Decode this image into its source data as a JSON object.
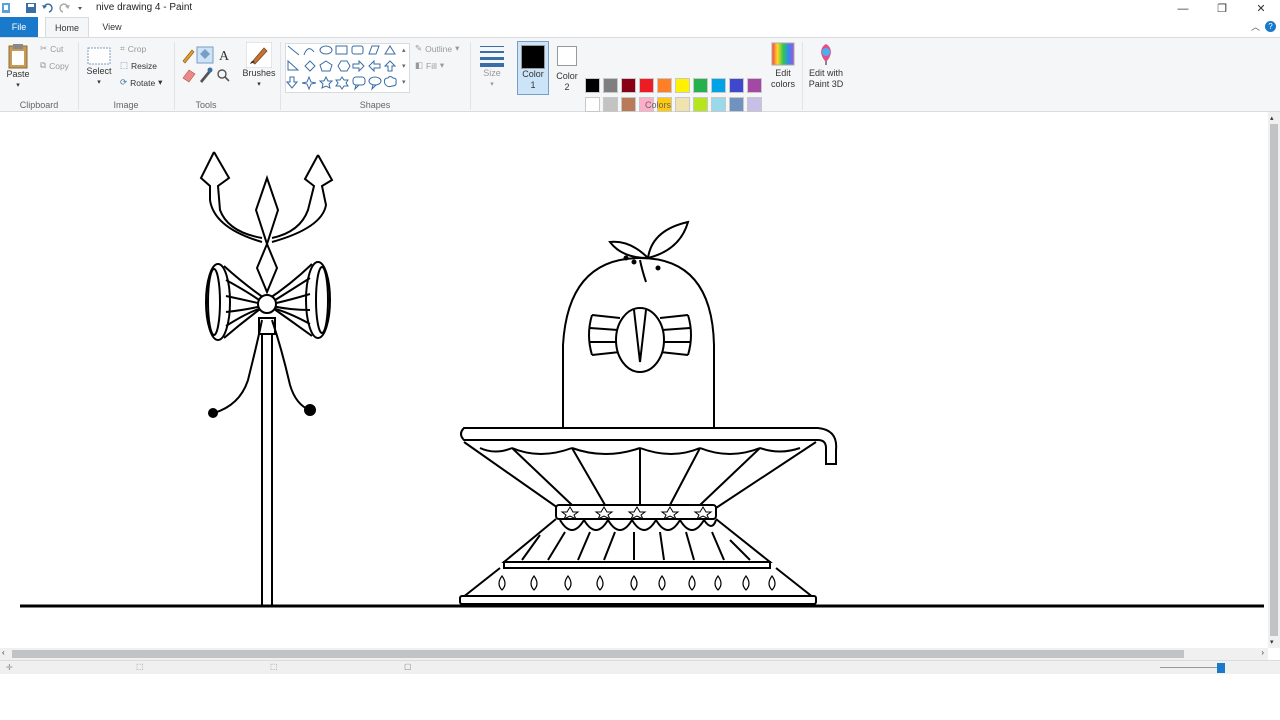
{
  "window": {
    "title": "nive drawing 4 - Paint",
    "minimize": "—",
    "restore": "❐",
    "close": "✕"
  },
  "tabs": {
    "file": "File",
    "home": "Home",
    "view": "View",
    "help": "?"
  },
  "ribbon": {
    "clipboard": {
      "paste": "Paste",
      "cut": "Cut",
      "copy": "Copy",
      "label": "Clipboard"
    },
    "image": {
      "select": "Select",
      "crop": "Crop",
      "resize": "Resize",
      "rotate": "Rotate",
      "label": "Image"
    },
    "tools": {
      "brushes": "Brushes",
      "label": "Tools"
    },
    "shapes": {
      "outline": "Outline",
      "fill": "Fill",
      "label": "Shapes"
    },
    "size": {
      "label": "Size"
    },
    "colors": {
      "color1": "Color",
      "color1_num": "1",
      "color2": "Color",
      "color2_num": "2",
      "edit_colors_1": "Edit",
      "edit_colors_2": "colors",
      "edit_3d_1": "Edit with",
      "edit_3d_2": "Paint 3D",
      "label": "Colors",
      "palette": [
        "#000000",
        "#7f7f7f",
        "#880015",
        "#ed1c24",
        "#ff7f27",
        "#fff200",
        "#22b14c",
        "#00a2e8",
        "#3f48cc",
        "#a349a4",
        "#ffffff",
        "#c3c3c3",
        "#b97a57",
        "#ffaec9",
        "#ffc90e",
        "#efe4b0",
        "#b5e61d",
        "#99d9ea",
        "#7092be",
        "#c8bfe7"
      ],
      "color1_value": "#000000",
      "color2_value": "#ffffff"
    }
  },
  "accent": "#1979ca"
}
